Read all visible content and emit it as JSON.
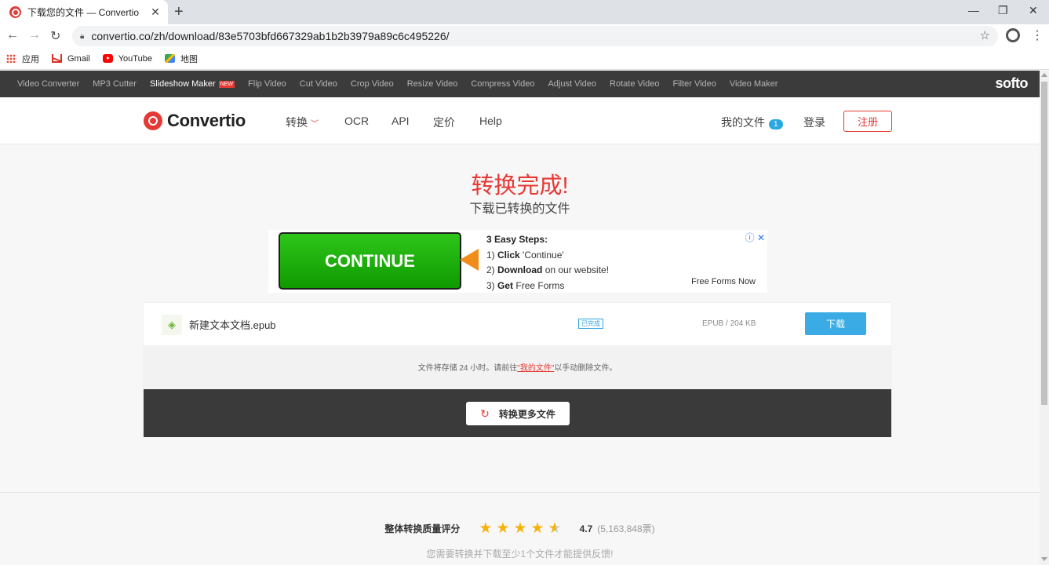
{
  "browser": {
    "tab_title": "下载您的文件 — Convertio",
    "tab_close": "✕",
    "new_tab": "+",
    "url": "convertio.co/zh/download/83e5703bfd667329ab1b2b3979a89c6c495226/",
    "bookmarks": [
      {
        "label": "应用",
        "icon": "apps-icon"
      },
      {
        "label": "Gmail",
        "icon": "gmail-icon"
      },
      {
        "label": "YouTube",
        "icon": "youtube-icon"
      },
      {
        "label": "地图",
        "icon": "maps-icon"
      }
    ]
  },
  "softo_bar": {
    "links": [
      "Video Converter",
      "MP3 Cutter",
      "Slideshow Maker",
      "Flip Video",
      "Cut Video",
      "Crop Video",
      "Resize Video",
      "Compress Video",
      "Adjust Video",
      "Rotate Video",
      "Filter Video",
      "Video Maker"
    ],
    "new_badge": "NEW",
    "brand": "softo"
  },
  "header": {
    "logo_text": "Convertio",
    "nav": [
      "转换",
      "OCR",
      "API",
      "定价",
      "Help"
    ],
    "my_files": "我的文件",
    "my_files_count": "1",
    "login": "登录",
    "register": "注册"
  },
  "main": {
    "title": "转换完成!",
    "subtitle": "下载已转换的文件"
  },
  "ad": {
    "button": "CONTINUE",
    "steps_title": "3 Easy Steps:",
    "step1_num": "1)",
    "step1_bold": "Click",
    "step1_rest": "'Continue'",
    "step2_num": "2)",
    "step2_bold": "Download",
    "step2_rest": "on our website!",
    "step3_num": "3)",
    "step3_bold": "Get",
    "step3_rest": "Free Forms",
    "sponsor": "Free Forms Now",
    "info": "ⓘ ✕"
  },
  "file": {
    "name": "新建文本文档.epub",
    "status": "已完成",
    "meta": "EPUB / 204 KB",
    "download": "下载"
  },
  "note": {
    "before": "文件将存储 24 小时。请前往",
    "link": "\"我的文件\"",
    "after": "以手动删除文件。"
  },
  "convert_more": "转换更多文件",
  "rating": {
    "label": "整体转换质量评分",
    "stars": 4.7,
    "score": "4.7",
    "votes": "(5,163,848票)",
    "feedback": "您需要转换并下载至少1个文件才能提供反馈!"
  },
  "colors": {
    "accent": "#e53935",
    "blue": "#3aabe4",
    "dark_bar": "#3b3b3b"
  }
}
